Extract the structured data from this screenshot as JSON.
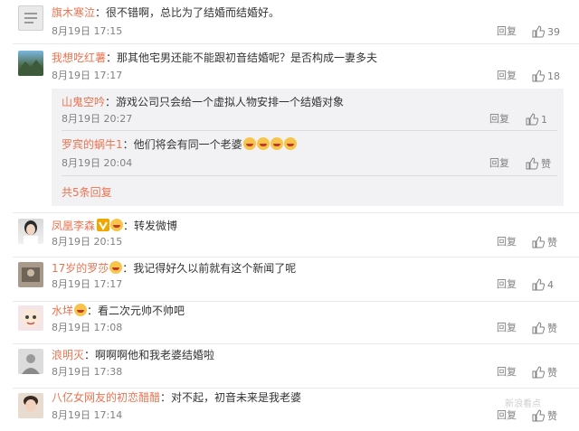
{
  "comments": [
    {
      "user": "旗木寒泣",
      "text": "：很不错啊，总比为了结婚而结婚好。",
      "date": "8月19日 17:15",
      "reply": "回复",
      "likes": "39"
    },
    {
      "user": "我想吃红薯",
      "text": "：那其他宅男还能不能跟初音结婚呢？是否构成一妻多夫",
      "date": "8月19日 17:17",
      "reply": "回复",
      "likes": "18"
    },
    {
      "user": "凤凰李森",
      "text": "：转发微博",
      "date": "8月19日 20:15",
      "reply": "回复",
      "likes": "赞"
    },
    {
      "user": "17岁的罗莎",
      "text": "：我记得好久以前就有这个新闻了呢",
      "date": "8月19日 17:17",
      "reply": "回复",
      "likes": "4"
    },
    {
      "user": "水垟",
      "text": "：看二次元帅不帅吧",
      "date": "8月19日 17:08",
      "reply": "回复",
      "likes": "赞"
    },
    {
      "user": "浪明灭",
      "text": "：啊啊啊他和我老婆结婚啦",
      "date": "8月19日 17:38",
      "reply": "回复",
      "likes": "赞"
    },
    {
      "user": "八亿女网友的初恋醋醋",
      "text": "：对不起，初音未来是我老婆",
      "date": "8月19日 17:14",
      "reply": "回复",
      "likes": "赞"
    }
  ],
  "subreplies": [
    {
      "user": "山鬼空吟",
      "text": "：游戏公司只会给一个虚拟人物安排一个结婚对象",
      "date": "8月19日 20:27",
      "reply": "回复",
      "likes": "1"
    },
    {
      "user": "罗宾的蜗牛1",
      "text": "：他们将会有同一个老婆",
      "date": "8月19日 20:04",
      "reply": "回复",
      "likes": "赞"
    }
  ],
  "more_replies": "共5条回复",
  "watermark": "新浪看点",
  "colors": {
    "username": "#eb7350",
    "meta": "#808080",
    "subbox": "#f2f2f5"
  }
}
